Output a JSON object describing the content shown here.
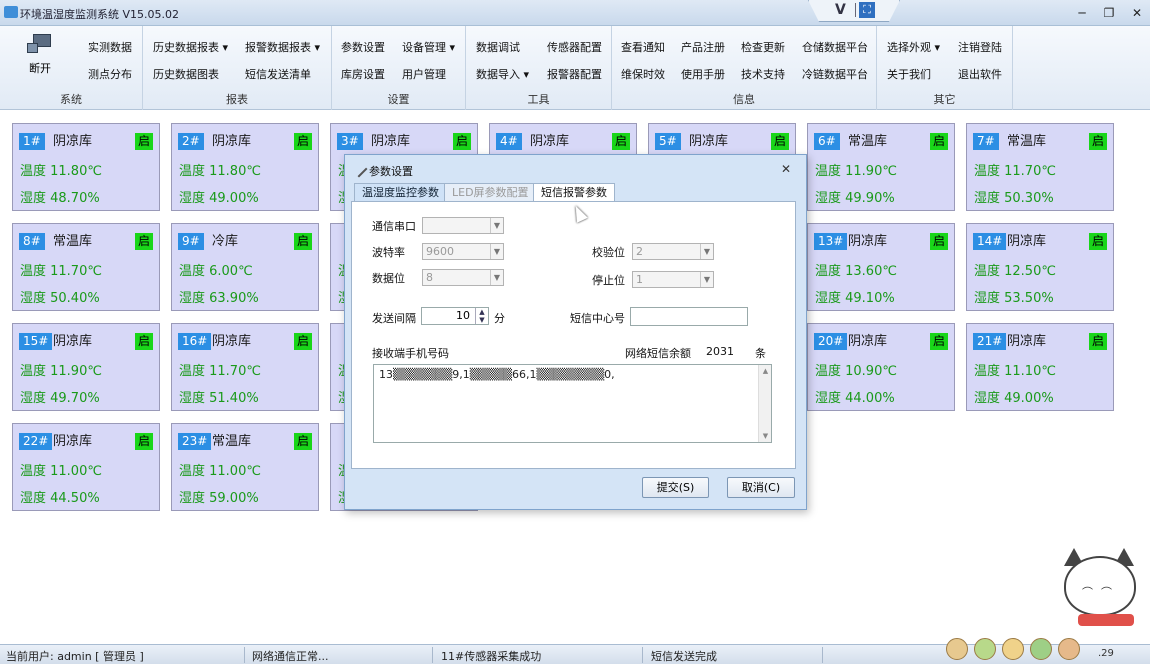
{
  "window": {
    "title": "环境温湿度监测系统 V15.05.02",
    "controls": {
      "minimize": "─",
      "maximize": "❐",
      "close": "✕"
    },
    "logo": {
      "letter": "V",
      "expand_glyph": "⛶"
    }
  },
  "ribbon": {
    "groups": [
      {
        "label": "系统"
      },
      {
        "label": "报表"
      },
      {
        "label": "设置"
      },
      {
        "label": "工具"
      },
      {
        "label": "信息"
      },
      {
        "label": "其它"
      }
    ],
    "system": {
      "disconnect": "断开",
      "realtime": "实测数据",
      "points": "测点分布"
    },
    "report": {
      "history_report": "历史数据报表 ▾",
      "history_chart": "历史数据图表",
      "alarm_report": "报警数据报表 ▾",
      "sms_list": "短信发送清单"
    },
    "settings": {
      "params": "参数设置",
      "warehouse": "库房设置",
      "device_mgmt": "设备管理 ▾",
      "user_mgmt": "用户管理"
    },
    "tools": {
      "debug": "数据调试",
      "import": "数据导入 ▾",
      "sensor_cfg": "传感器配置",
      "alarm_cfg": "报警器配置"
    },
    "info": {
      "notice": "查看通知",
      "maintenance": "维保时效",
      "register": "产品注册",
      "manual": "使用手册",
      "update": "检查更新",
      "support": "技术支持",
      "storage_platform": "仓储数据平台",
      "cold_platform": "冷链数据平台"
    },
    "other": {
      "skin": "选择外观 ▾",
      "about": "关于我们",
      "logout": "注销登陆",
      "exit": "退出软件"
    }
  },
  "cards": [
    {
      "num": "1#",
      "name": "阴凉库",
      "status": "启",
      "temp": "温度 11.80℃",
      "hum": "湿度 48.70%"
    },
    {
      "num": "2#",
      "name": "阴凉库",
      "status": "启",
      "temp": "温度 11.80℃",
      "hum": "湿度 49.00%"
    },
    {
      "num": "3#",
      "name": "阴凉库",
      "status": "启",
      "temp": "温",
      "hum": "湿"
    },
    {
      "num": "4#",
      "name": "阴凉库",
      "status": "启",
      "temp": "",
      "hum": ""
    },
    {
      "num": "5#",
      "name": "阴凉库",
      "status": "启",
      "temp": "",
      "hum": ""
    },
    {
      "num": "6#",
      "name": "常温库",
      "status": "启",
      "temp": "温度 11.90℃",
      "hum": "湿度 49.90%"
    },
    {
      "num": "7#",
      "name": "常温库",
      "status": "启",
      "temp": "温度 11.70℃",
      "hum": "湿度 50.30%"
    },
    {
      "num": "8#",
      "name": "常温库",
      "status": "启",
      "temp": "温度 11.70℃",
      "hum": "湿度 50.40%"
    },
    {
      "num": "9#",
      "name": "冷库",
      "status": "启",
      "temp": "温度 6.00℃",
      "hum": "湿度 63.90%"
    },
    {
      "num": "13#",
      "name": "阴凉库",
      "status": "启",
      "temp": "温度 13.60℃",
      "hum": "湿度 49.10%"
    },
    {
      "num": "14#",
      "name": "阴凉库",
      "status": "启",
      "temp": "温度 12.50℃",
      "hum": "湿度 53.50%"
    },
    {
      "num": "15#",
      "name": "阴凉库",
      "status": "启",
      "temp": "温度 11.90℃",
      "hum": "湿度 49.70%"
    },
    {
      "num": "16#",
      "name": "阴凉库",
      "status": "启",
      "temp": "温度 11.70℃",
      "hum": "湿度 51.40%"
    },
    {
      "num": "20#",
      "name": "阴凉库",
      "status": "启",
      "temp": "温度 10.90℃",
      "hum": "湿度 44.00%"
    },
    {
      "num": "21#",
      "name": "阴凉库",
      "status": "启",
      "temp": "温度 11.10℃",
      "hum": "湿度 49.00%"
    },
    {
      "num": "22#",
      "name": "阴凉库",
      "status": "启",
      "temp": "温度 11.00℃",
      "hum": "湿度 44.50%"
    },
    {
      "num": "23#",
      "name": "常温库",
      "status": "启",
      "temp": "温度 11.00℃",
      "hum": "湿度 59.00%"
    }
  ],
  "partial_cards": [
    {
      "temp": "温",
      "hum": "湿"
    },
    {
      "temp": "温",
      "hum": "湿"
    },
    {
      "temp": "温",
      "hum": "湿"
    },
    {
      "temp": "温",
      "hum": "湿"
    }
  ],
  "dialog": {
    "title": "参数设置",
    "close": "✕",
    "tabs": {
      "ths": "温湿度监控参数",
      "led": "LED屏参数配置",
      "sms": "短信报警参数"
    },
    "fields": {
      "port_label": "通信串口",
      "port_value": "",
      "baud_label": "波特率",
      "baud_value": "9600",
      "databits_label": "数据位",
      "databits_value": "8",
      "parity_label": "校验位",
      "parity_value": "2",
      "stopbits_label": "停止位",
      "stopbits_value": "1",
      "interval_label": "发送间隔",
      "interval_value": "10",
      "interval_unit": "分",
      "center_label": "短信中心号",
      "center_value": "",
      "phones_label": "接收端手机号码",
      "balance_label": "网络短信余额",
      "balance_value": "2031",
      "balance_unit": "条",
      "phones_value": "13▒▒▒▒▒▒▒9,1▒▒▒▒▒66,1▒▒▒▒▒▒▒▒0,"
    },
    "buttons": {
      "submit": "提交(S)",
      "cancel": "取消(C)"
    }
  },
  "statusbar": {
    "user": "当前用户: admin [ 管理员 ]",
    "network": "网络通信正常...",
    "sensor": "11#传感器采集成功",
    "sms": "短信发送完成",
    "time": ".29"
  },
  "colors": {
    "card_bg": "#d7d8f7",
    "card_num": "#2c8fe4",
    "status_on": "#19d619",
    "reading": "#1a9a1a"
  }
}
